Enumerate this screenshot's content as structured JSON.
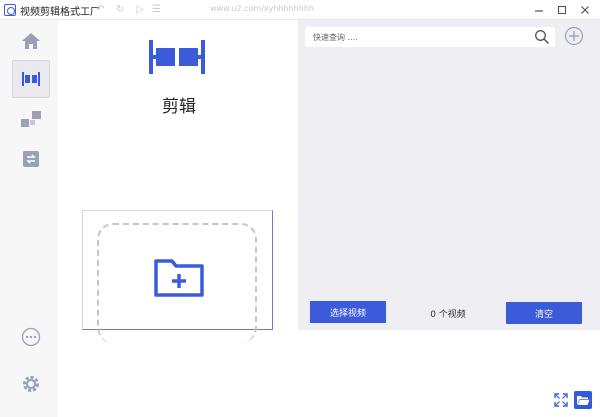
{
  "window": {
    "title": "视频剪辑格式工厂",
    "faint_url": "www.u2.com/xyhhhhhhhh"
  },
  "sidebar": {
    "items": [
      {
        "name": "home"
      },
      {
        "name": "cut",
        "active": true
      },
      {
        "name": "merge"
      },
      {
        "name": "convert"
      }
    ]
  },
  "main": {
    "mode_label": "剪辑"
  },
  "search": {
    "placeholder": "快速查询 ....",
    "value": ""
  },
  "actions": {
    "select_video": "选择视频",
    "clear": "清空",
    "count": "0 个视频"
  },
  "colors": {
    "accent": "#3b5bdb",
    "panel_bg": "#efeff3",
    "sidebar_bg": "#f7f7f7"
  }
}
